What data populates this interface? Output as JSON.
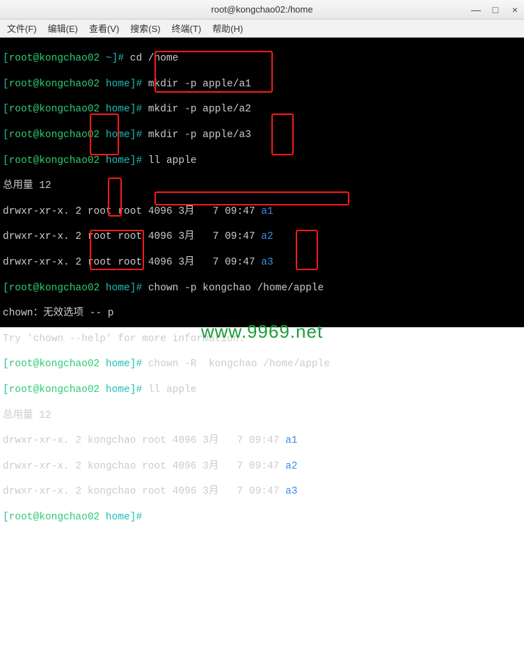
{
  "window": {
    "title": "root@kongchao02:/home",
    "controls": {
      "min": "—",
      "max": "□",
      "close": "×"
    }
  },
  "menu": {
    "file": "文件(F)",
    "edit": "编辑(E)",
    "view": "查看(V)",
    "search": "搜索(S)",
    "terminal": "终端(T)",
    "help": "帮助(H)"
  },
  "prompt": {
    "open": "[",
    "user_host": "root@kongchao02",
    "home_path": " ~",
    "work_path": " home",
    "close": "]# "
  },
  "commands": {
    "cd": "cd /home",
    "mkdir1": "mkdir -p apple/a1",
    "mkdir2": "mkdir -p apple/a2",
    "mkdir3": "mkdir -p apple/a3",
    "ll1": "ll apple",
    "chown_p": "chown -p kongchao /home/apple",
    "chown_R": "chown -R  kongchao /home/apple",
    "ll2": "ll apple"
  },
  "output": {
    "total": "总用量 12",
    "err1": "chown：无效选项 -- p",
    "err2": "Try 'chown --help' for more information."
  },
  "ls1": [
    {
      "perm": "drwxr-xr-x. 2 ",
      "owner": "root",
      "rest": " root 4096 3月   7 09:47 ",
      "name": "a1"
    },
    {
      "perm": "drwxr-xr-x. 2 ",
      "owner": "root",
      "rest": " root 4096 3月   7 09:47 ",
      "name": "a2"
    },
    {
      "perm": "drwxr-xr-x. 2 ",
      "owner": "root",
      "rest": " root 4096 3月   7 09:47 ",
      "name": "a3"
    }
  ],
  "ls2": [
    {
      "perm": "drwxr-xr-x. 2 ",
      "owner": "kongchao",
      "rest": " root 4096 3月   7 09:47 ",
      "name": "a1"
    },
    {
      "perm": "drwxr-xr-x. 2 ",
      "owner": "kongchao",
      "rest": " root 4096 3月   7 09:47 ",
      "name": "a2"
    },
    {
      "perm": "drwxr-xr-x. 2 ",
      "owner": "kongchao",
      "rest": " root 4096 3月   7 09:47 ",
      "name": "a3"
    }
  ],
  "watermark": "www.9969.net"
}
